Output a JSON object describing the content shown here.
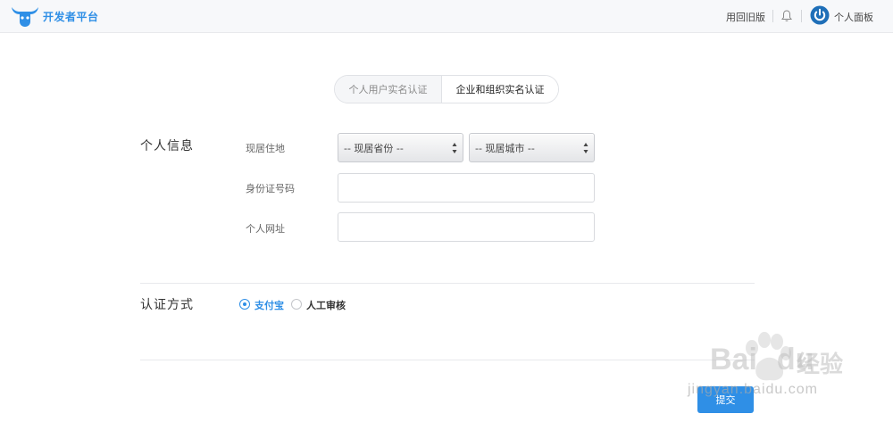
{
  "header": {
    "brand": "开发者平台",
    "old_version": "用回旧版",
    "panel_label": "个人面板",
    "brand_color": "#2f8fe6",
    "icons": [
      "bull-logo-icon",
      "bell-icon",
      "power-icon"
    ]
  },
  "tabs": [
    {
      "label": "个人用户实名认证",
      "active": false
    },
    {
      "label": "企业和组织实名认证",
      "active": true
    }
  ],
  "personal_info": {
    "title": "个人信息",
    "residence_label": "现居住地",
    "province_select": "-- 现居省份 --",
    "city_select": "-- 现居城市 --",
    "id_label": "身份证号码",
    "id_value": "",
    "website_label": "个人网址",
    "website_value": ""
  },
  "verification": {
    "title": "认证方式",
    "options": [
      {
        "label": "支付宝",
        "checked": true,
        "color": "#2f8fe6"
      },
      {
        "label": "人工审核",
        "checked": false,
        "color": "#333333"
      }
    ]
  },
  "submit_label": "提交",
  "watermark": {
    "brand": "Bai",
    "brand2": "du",
    "cn": "经验",
    "url": "jingyan.baidu.com"
  }
}
